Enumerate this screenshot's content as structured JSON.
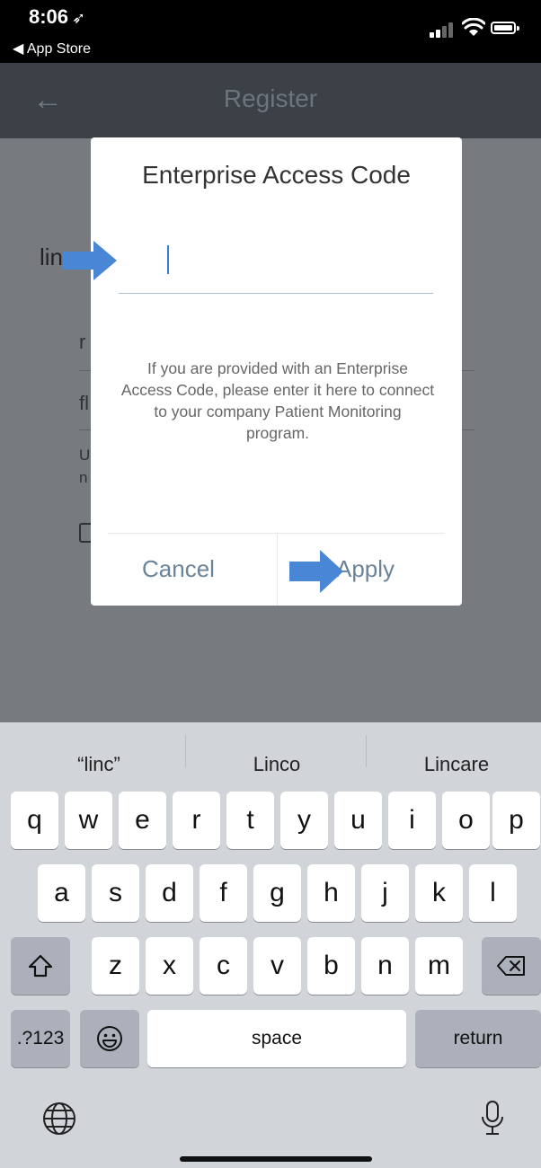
{
  "status_bar": {
    "time": "8:06",
    "back_app": "◀ App Store"
  },
  "app_bar": {
    "title": "Register"
  },
  "background_hints": [
    "r",
    "fl",
    "U",
    "n"
  ],
  "dialog": {
    "title": "Enterprise Access Code",
    "input_value": "linc",
    "info_text": "If you are provided with an Enterprise Access Code, please enter it here to connect to your company Patient Monitoring program.",
    "cancel_label": "Cancel",
    "apply_label": "Apply"
  },
  "keyboard": {
    "suggestions": [
      "“linc”",
      "Linco",
      "Lincare"
    ],
    "row1": [
      "q",
      "w",
      "e",
      "r",
      "t",
      "y",
      "u",
      "i",
      "o",
      "p"
    ],
    "row2": [
      "a",
      "s",
      "d",
      "f",
      "g",
      "h",
      "j",
      "k",
      "l"
    ],
    "row3": [
      "z",
      "x",
      "c",
      "v",
      "b",
      "n",
      "m"
    ],
    "numbers_label": ".?123",
    "space_label": "space",
    "return_label": "return"
  },
  "colors": {
    "accent_arrow": "#4a86d6",
    "button_text": "#6b8399"
  }
}
